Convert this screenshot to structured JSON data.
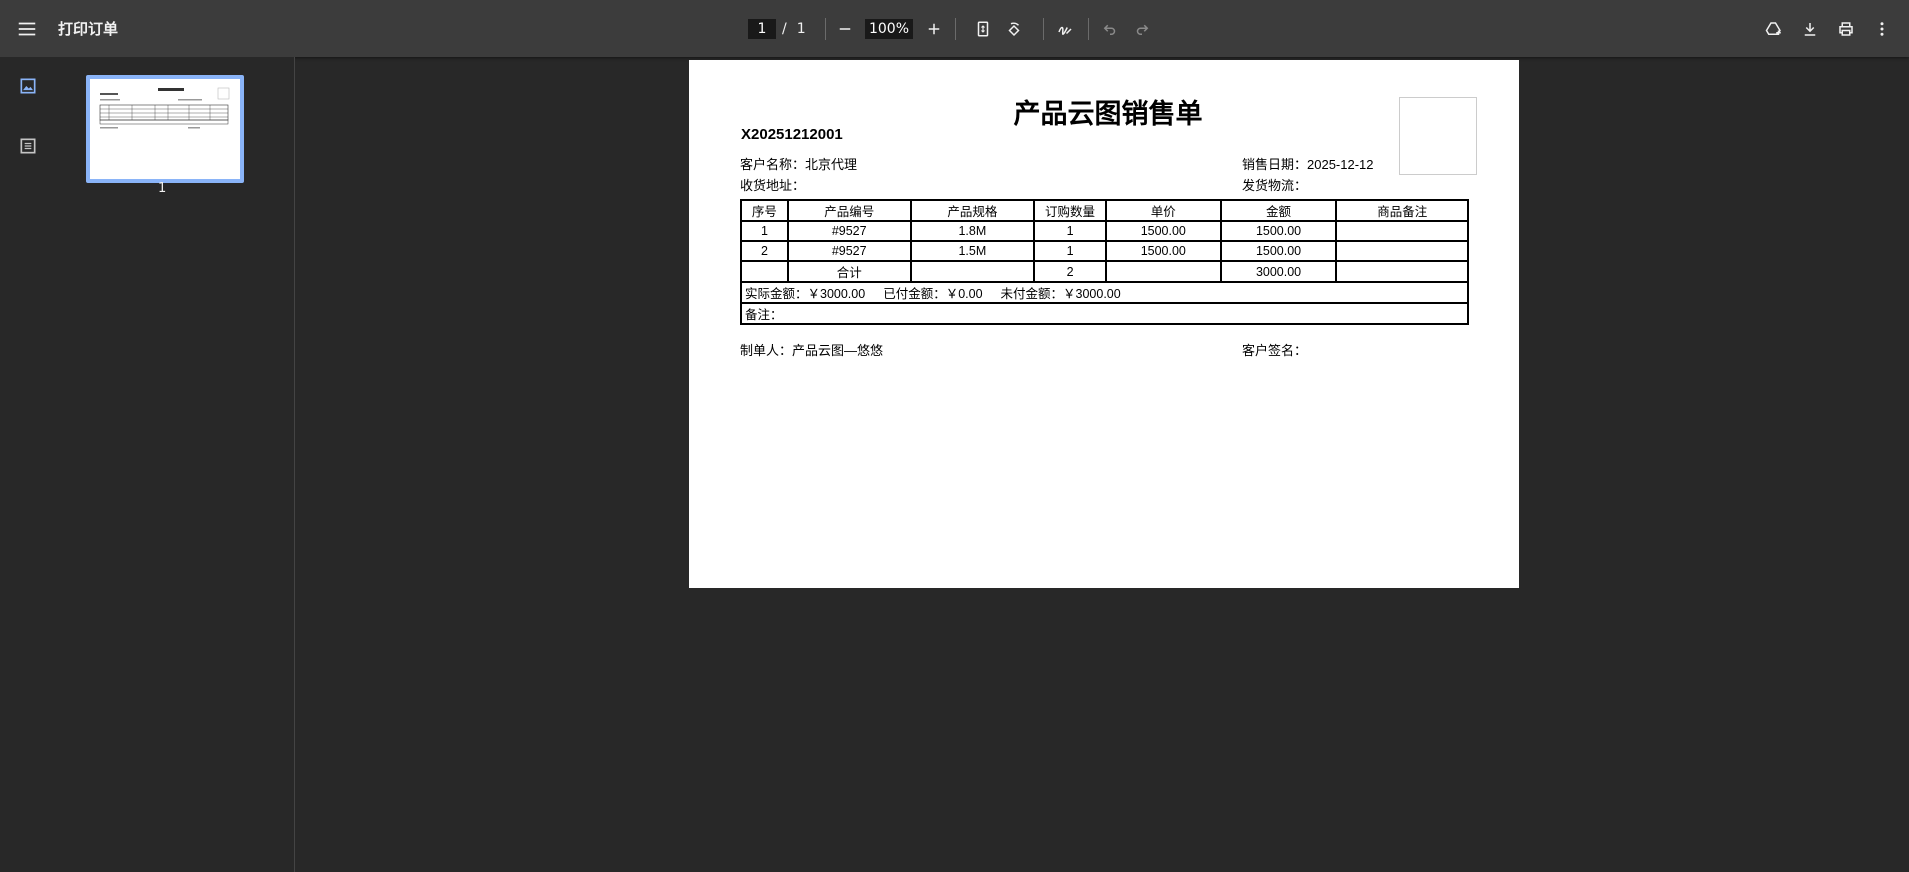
{
  "toolbar": {
    "title": "打印订单",
    "current_page": "1",
    "page_separator": "/",
    "total_pages": "1",
    "zoom": "100%"
  },
  "sidebar": {
    "thumbnail_page_label": "1"
  },
  "document": {
    "title": "产品云图销售单",
    "order_no": "X20251212001",
    "customer_label": "客户名称：",
    "customer_name": "北京代理",
    "sale_date_label": "销售日期：",
    "sale_date": "2025-12-12",
    "address_label": "收货地址：",
    "address": "",
    "logistics_label": "发货物流：",
    "logistics": "",
    "table": {
      "headers": [
        "序号",
        "产品编号",
        "产品规格",
        "订购数量",
        "单价",
        "金额",
        "商品备注"
      ],
      "rows": [
        [
          "1",
          "#9527",
          "1.8M",
          "1",
          "1500.00",
          "1500.00",
          ""
        ],
        [
          "2",
          "#9527",
          "1.5M",
          "1",
          "1500.00",
          "1500.00",
          ""
        ]
      ],
      "total_label": "合计",
      "total_qty": "2",
      "total_amount": "3000.00"
    },
    "actual_amount": "实际金额：￥3000.00",
    "paid_amount": "已付金额：￥0.00",
    "unpaid_amount": "未付金额：￥3000.00",
    "remark_label": "备注：",
    "maker_label": "制单人：",
    "maker_name": "产品云图—悠悠",
    "signature_label": "客户签名："
  },
  "colors": {
    "toolbar_bg": "#3c3c3c",
    "viewer_bg": "#282828",
    "thumb_border": "#8ab4f8"
  }
}
